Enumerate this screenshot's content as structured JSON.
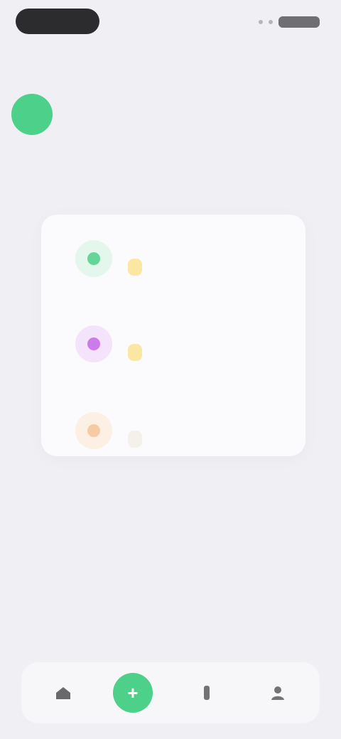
{
  "status_bar": {
    "time": "",
    "battery": ""
  },
  "topnav": {
    "left": "",
    "center": "",
    "right": "",
    "right_sub": ""
  },
  "fab": {
    "icon": "plus-icon",
    "color": "#4cd08a"
  },
  "activities": [
    {
      "title": "",
      "badge": "",
      "icon": "activity-icon",
      "color": "#4cd08a",
      "bg": "#e3f7ec"
    },
    {
      "title": "",
      "badge": "",
      "icon": "activity-icon",
      "color": "#c667e6",
      "bg": "#f4e4fb"
    },
    {
      "title": "",
      "badge": "",
      "icon": "activity-icon",
      "color": "#f2b27a",
      "bg": "#fcefe4"
    }
  ],
  "more_link": "",
  "hint": "",
  "bottom": {
    "left_label": "",
    "right_link": ""
  },
  "tabs": [
    {
      "label": "",
      "icon": "home-icon"
    },
    {
      "label": "",
      "icon": "add-icon",
      "active": true
    },
    {
      "label": "",
      "icon": "stats-icon"
    },
    {
      "label": "",
      "icon": "profile-icon"
    }
  ],
  "colors": {
    "accent": "#4cd08a",
    "badge": "#fbe7a1",
    "background": "#efeff4"
  }
}
